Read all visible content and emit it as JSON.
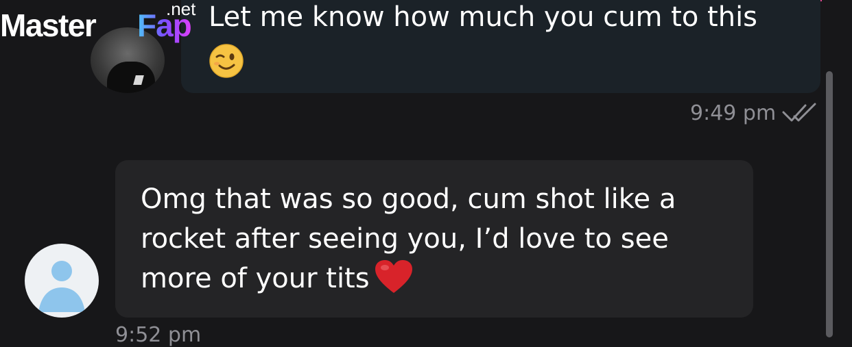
{
  "watermark": {
    "brand_main": "Master",
    "brand_accent": "Fap",
    "brand_tld": ".net"
  },
  "conversation": {
    "outgoing": {
      "text": "Let me know how much you cum to this",
      "emoji": "winking-face",
      "time": "9:49 pm",
      "status_icon": "double-check-icon"
    },
    "incoming": {
      "text": "Omg that was so good, cum shot like a rocket after seeing you, I’d love to see more of your tits",
      "emoji": "red-heart",
      "time": "9:52 pm"
    }
  },
  "colors": {
    "background": "#171719",
    "outgoing_bubble": "#1b2228",
    "incoming_bubble": "#242426",
    "timestamp": "#8f8f95",
    "accent_line": "#e0498f",
    "default_avatar_blue": "#8ec5ec"
  }
}
